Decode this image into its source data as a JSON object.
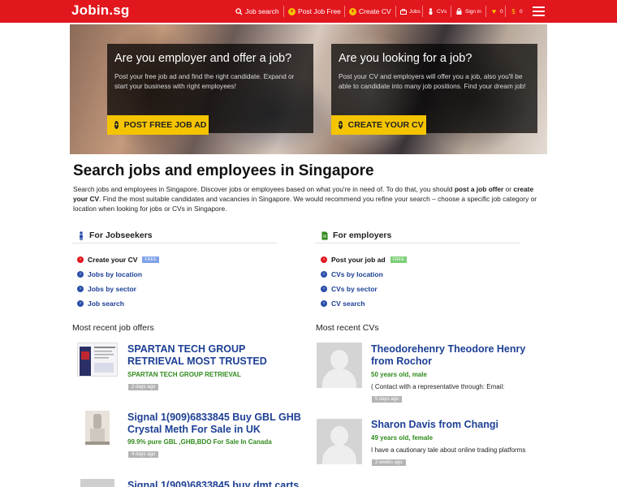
{
  "header": {
    "logo": "Jobin.sg",
    "nav": {
      "job_search": "Job search",
      "post_job": "Post Job Free",
      "create_cv": "Create CV",
      "jobs": "Jobs",
      "cvs": "CVs",
      "sign_in": "Sign in",
      "favorites_count": "0",
      "saved_count": "0"
    },
    "colors": {
      "bar": "#e2161d",
      "accent": "#f5c400"
    },
    "icons": [
      "search-icon",
      "plus-circle-icon",
      "plus-circle-icon",
      "briefcase-icon",
      "person-icon",
      "lock-icon",
      "heart-icon",
      "money-icon",
      "menu-icon"
    ]
  },
  "hero": {
    "employer": {
      "title": "Are you employer and offer a job?",
      "text": "Post your free job ad and find the right candidate. Expand or start your business with right employees!",
      "button": "POST FREE JOB AD"
    },
    "seeker": {
      "title": "Are you looking for a job?",
      "text": "Post your CV and employers will offer you a job, also you'll be able to candidate into many job positions. Find your dream job!",
      "button": "CREATE YOUR CV"
    }
  },
  "main": {
    "title": "Search jobs and employees in Singapore",
    "intro": {
      "part1": "Search jobs and employees in Singapore. Discover jobs or employees based on what you're in need of. To do that, you should ",
      "bold1": "post a job offer",
      "part2": " or ",
      "bold2": "create your CV",
      "part3": ". Find the most suitable candidates and vacancies in Singapore. We would recommend you refine your search – choose a specific job category or location when looking for jobs or CVs in Singapore."
    },
    "jobseekers": {
      "heading": "For Jobseekers",
      "links": [
        {
          "label": "Create your CV",
          "badge": "FREE"
        },
        {
          "label": "Jobs by location"
        },
        {
          "label": "Jobs by sector"
        },
        {
          "label": "Job search"
        }
      ]
    },
    "employers": {
      "heading": "For employers",
      "links": [
        {
          "label": "Post your job ad",
          "badge": "FREE"
        },
        {
          "label": "CVs by location"
        },
        {
          "label": "CVs by sector"
        },
        {
          "label": "CV search"
        }
      ]
    },
    "recent_jobs": {
      "heading": "Most recent job offers",
      "items": [
        {
          "title": "SPARTAN TECH GROUP RETRIEVAL MOST TRUSTED",
          "company": "SPARTAN TECH GROUP RETRIEVAL",
          "age": "2 days ago"
        },
        {
          "title": "Signal 1(909)6833845 Buy GBL GHB Crystal Meth For Sale in UK",
          "company": "99.9% pure GBL ,GHB,BDO For Sale In Canada",
          "age": "4 days ago"
        },
        {
          "title": "Signal 1(909)6833845 buy dmt carts"
        }
      ]
    },
    "recent_cvs": {
      "heading": "Most recent CVs",
      "items": [
        {
          "name": "Theodorehenry Theodore Henry from Rochor",
          "meta": "50 years old, male",
          "desc": "( Contact with a representative through: Email:",
          "age": "5 days ago"
        },
        {
          "name": "Sharon Davis from Changi",
          "meta": "49 years old, female",
          "desc": "I have a cautionary tale about online trading platforms",
          "age": "2 weeks ago"
        }
      ]
    }
  }
}
